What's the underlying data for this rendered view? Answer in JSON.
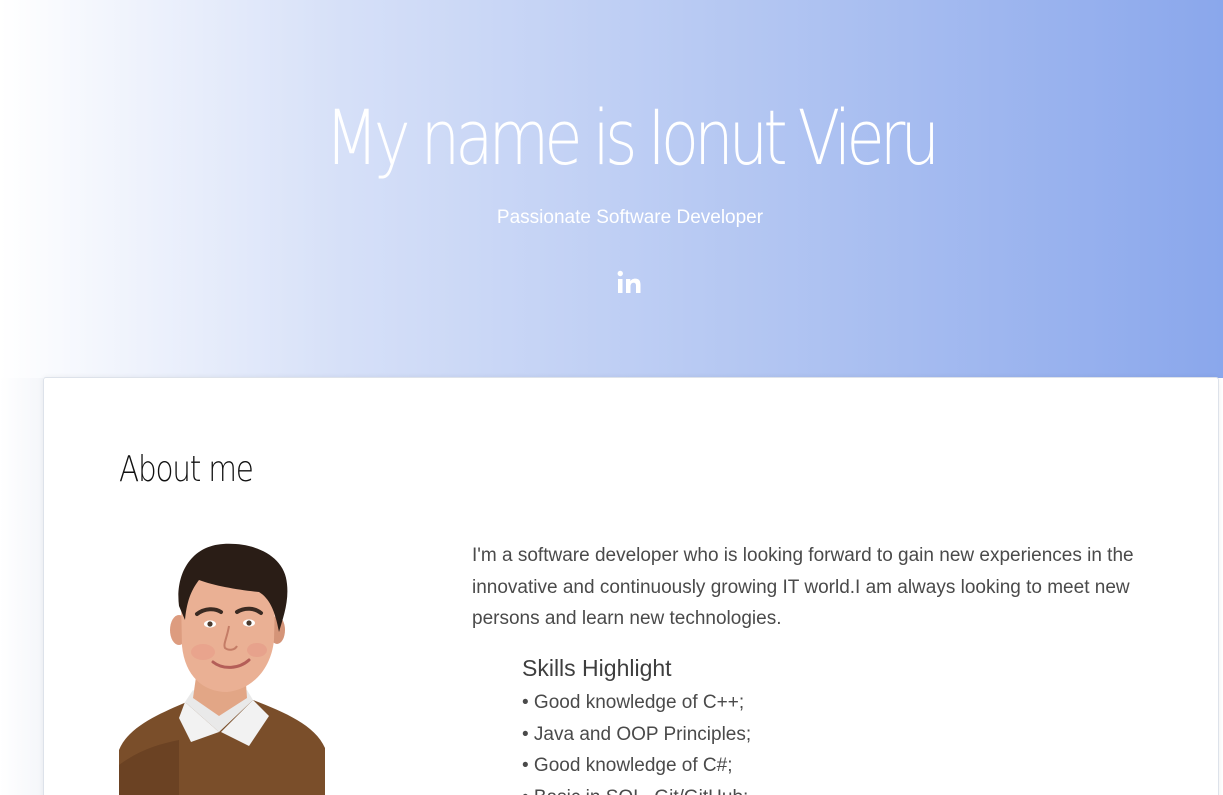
{
  "hero": {
    "title": "My name is Ionut Vieru",
    "subtitle": "Passionate Software Developer",
    "social": [
      {
        "icon": "linkedin-icon",
        "label": "in"
      }
    ]
  },
  "about": {
    "heading": "About me",
    "intro": "I'm a software developer who is looking forward to gain new experiences in the innovative and continuously growing IT world.I am always looking to meet new persons and learn new technologies.",
    "skills_heading": "Skills Highlight",
    "skills": [
      "• Good knowledge of C++;",
      "• Java and OOP Principles;",
      "• Good knowledge of C#;",
      "• Basic in SQL, Git/GitHub;"
    ]
  },
  "colors": {
    "hero_gradient_start": "#ffffff",
    "hero_gradient_end": "#8aa7ec",
    "heading_text": "#111111",
    "body_text": "#4a4a4a"
  }
}
